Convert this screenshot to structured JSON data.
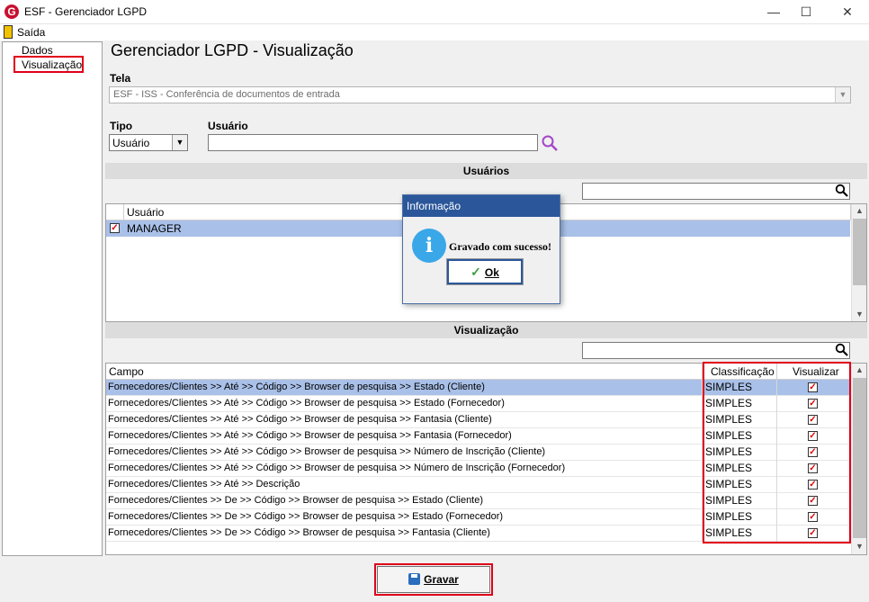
{
  "window": {
    "title": "ESF - Gerenciador LGPD",
    "app_icon": "G",
    "minimize": "—",
    "maximize": "☐",
    "close": "✕"
  },
  "menu": {
    "exit": "Saída"
  },
  "tree": {
    "items": [
      "Dados",
      "Visualização"
    ],
    "selected": "Visualização"
  },
  "main": {
    "title": "Gerenciador LGPD - Visualização",
    "tela_label": "Tela",
    "tela_value": "ESF - ISS - Conferência de documentos de entrada",
    "tipo_label": "Tipo",
    "tipo_value": "Usuário",
    "usuario_label": "Usuário",
    "usuario_value": ""
  },
  "users_section": {
    "header": "Usuários",
    "search_value": "",
    "column": "Usuário",
    "rows": [
      {
        "name": "MANAGER",
        "checked": true
      }
    ]
  },
  "view_section": {
    "header": "Visualização",
    "search_value": "",
    "columns": [
      "Campo",
      "Classificação",
      "Visualizar"
    ],
    "rows": [
      {
        "campo": "Fornecedores/Clientes >> Até >> Código >> Browser de pesquisa >> Estado (Cliente)",
        "classificacao": "SIMPLES",
        "visualizar": true
      },
      {
        "campo": "Fornecedores/Clientes >> Até >> Código >> Browser de pesquisa >> Estado (Fornecedor)",
        "classificacao": "SIMPLES",
        "visualizar": true
      },
      {
        "campo": "Fornecedores/Clientes >> Até >> Código >> Browser de pesquisa >> Fantasia (Cliente)",
        "classificacao": "SIMPLES",
        "visualizar": true
      },
      {
        "campo": "Fornecedores/Clientes >> Até >> Código >> Browser de pesquisa >> Fantasia (Fornecedor)",
        "classificacao": "SIMPLES",
        "visualizar": true
      },
      {
        "campo": "Fornecedores/Clientes >> Até >> Código >> Browser de pesquisa >> Número de Inscrição (Cliente)",
        "classificacao": "SIMPLES",
        "visualizar": true
      },
      {
        "campo": "Fornecedores/Clientes >> Até >> Código >> Browser de pesquisa >> Número de Inscrição (Fornecedor)",
        "classificacao": "SIMPLES",
        "visualizar": true
      },
      {
        "campo": "Fornecedores/Clientes >> Até >> Descrição",
        "classificacao": "SIMPLES",
        "visualizar": true
      },
      {
        "campo": "Fornecedores/Clientes >> De >> Código >> Browser de pesquisa >> Estado (Cliente)",
        "classificacao": "SIMPLES",
        "visualizar": true
      },
      {
        "campo": "Fornecedores/Clientes >> De >> Código >> Browser de pesquisa >> Estado (Fornecedor)",
        "classificacao": "SIMPLES",
        "visualizar": true
      },
      {
        "campo": "Fornecedores/Clientes >> De >> Código >> Browser de pesquisa >> Fantasia (Cliente)",
        "classificacao": "SIMPLES",
        "visualizar": true
      }
    ]
  },
  "dialog": {
    "title": "Informação",
    "message": "Gravado com sucesso!",
    "ok_label": "Ok",
    "icon": "i"
  },
  "footer": {
    "save_label": "Gravar"
  },
  "colors": {
    "accent": "#2b579a",
    "highlight": "#e0001a",
    "selected_row": "#a9c0e8"
  }
}
